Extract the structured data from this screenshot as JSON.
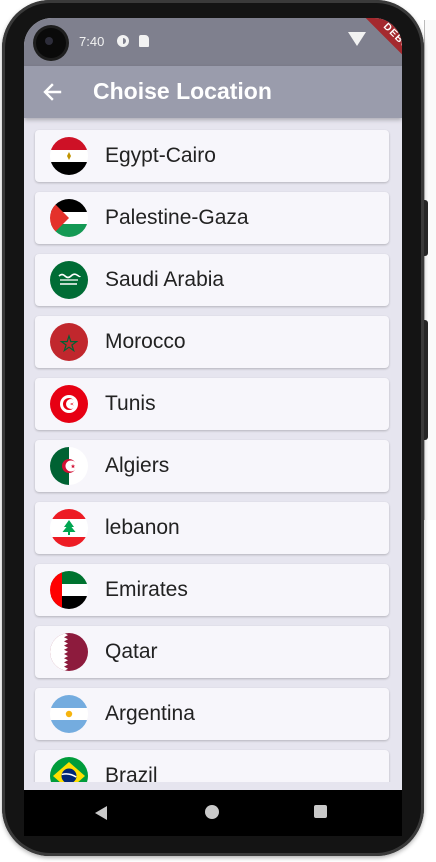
{
  "status_bar": {
    "time": "7:40",
    "icons": [
      "camera-cutout",
      "data-saver-icon",
      "sim-card-icon",
      "wifi-icon"
    ],
    "debug_banner": "DEBUG"
  },
  "app_bar": {
    "title": "Choise Location",
    "back_icon": "arrow-left-icon",
    "background": "#9a9cac"
  },
  "locations": [
    {
      "label": "Egypt-Cairo",
      "flag": "egypt-flag-icon"
    },
    {
      "label": "Palestine-Gaza",
      "flag": "palestine-flag-icon"
    },
    {
      "label": "Saudi Arabia",
      "flag": "saudi-arabia-flag-icon"
    },
    {
      "label": "Morocco",
      "flag": "morocco-flag-icon"
    },
    {
      "label": "Tunis",
      "flag": "tunisia-flag-icon"
    },
    {
      "label": "Algiers",
      "flag": "algeria-flag-icon"
    },
    {
      "label": "lebanon",
      "flag": "lebanon-flag-icon"
    },
    {
      "label": "Emirates",
      "flag": "uae-flag-icon"
    },
    {
      "label": "Qatar",
      "flag": "qatar-flag-icon"
    },
    {
      "label": "Argentina",
      "flag": "argentina-flag-icon"
    },
    {
      "label": "Brazil",
      "flag": "brazil-flag-icon"
    }
  ],
  "nav_bar": {
    "icons": [
      "nav-back-icon",
      "nav-home-icon",
      "nav-recents-icon"
    ]
  }
}
